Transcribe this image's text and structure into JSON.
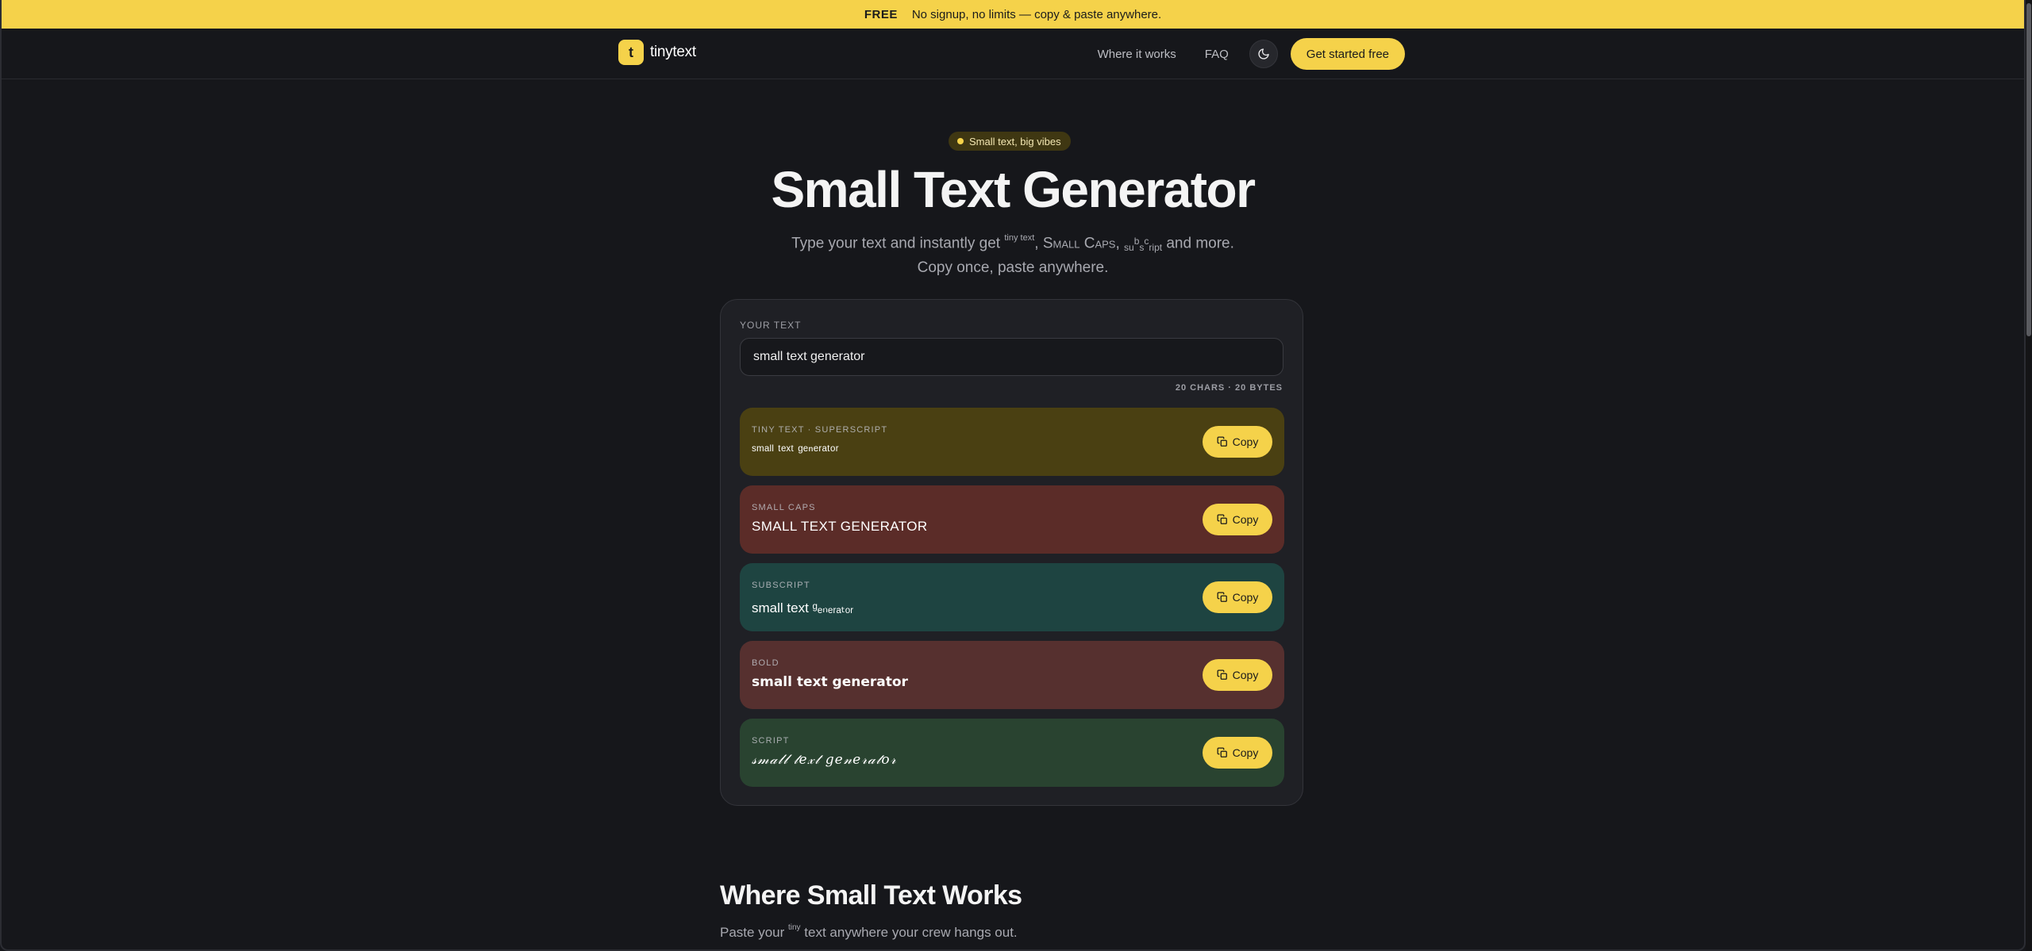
{
  "announcement": {
    "badge": "FREE",
    "text": "No signup, no limits — copy & paste anywhere."
  },
  "nav": {
    "logo_mark": "t",
    "brand": "tinytext",
    "links": [
      "Where it works",
      "FAQ"
    ],
    "theme_toggle_icon": "moon-icon",
    "cta": "Get started free"
  },
  "hero": {
    "badge": "Small text, big vibes",
    "title": "Small Text Generator",
    "subtitle_prefix": "Type your text and instantly get ",
    "subtitle_tiny": "tiny text",
    "subtitle_sep1": ", ",
    "subtitle_caps": "Small Caps",
    "subtitle_sep2": ", ",
    "subtitle_sub_1": "s",
    "subtitle_sub_2": "u",
    "subtitle_sub_3": "b",
    "subtitle_sub_4": "s",
    "subtitle_sub_5": "c",
    "subtitle_sub_6": "ript",
    "subtitle_suffix": " and more.",
    "subtitle_line2": "Copy once, paste anywhere."
  },
  "generator": {
    "input_label": "YOUR TEXT",
    "input_value": "small text generator",
    "counter": "20 CHARS · 20 BYTES",
    "copy_label": "Copy",
    "results": [
      {
        "label": "TINY TEXT · SUPERSCRIPT",
        "value": "ˢᵐᵃˡˡ ᵗᵉˣᵗ ᵍᵉⁿᵉʳᵃᵗᵒʳ",
        "color": "#4a4012"
      },
      {
        "label": "SMALL CAPS",
        "value": "SMALL TEXT GENERATOR",
        "color": "#5b2c28"
      },
      {
        "label": "SUBSCRIPT",
        "value": "small text ᵍₑₙₑᵣₐₜₒᵣ",
        "color": "#1e4441"
      },
      {
        "label": "BOLD",
        "value": "small text generator",
        "color": "#56302f"
      },
      {
        "label": "SCRIPT",
        "value": "𝓈𝓂𝒶𝓁𝓁 𝓉𝑒𝓍𝓉 𝑔𝑒𝓃𝑒𝓇𝒶𝓉𝑜𝓇",
        "color": "#294330"
      }
    ]
  },
  "where": {
    "title": "Where Small Text Works",
    "sub_prefix": "Paste your ",
    "sub_tiny": "tiny",
    "sub_suffix": " text anywhere your crew hangs out."
  },
  "colors": {
    "accent": "#f5d24a",
    "background": "#16171b",
    "card": "#1f2025"
  }
}
